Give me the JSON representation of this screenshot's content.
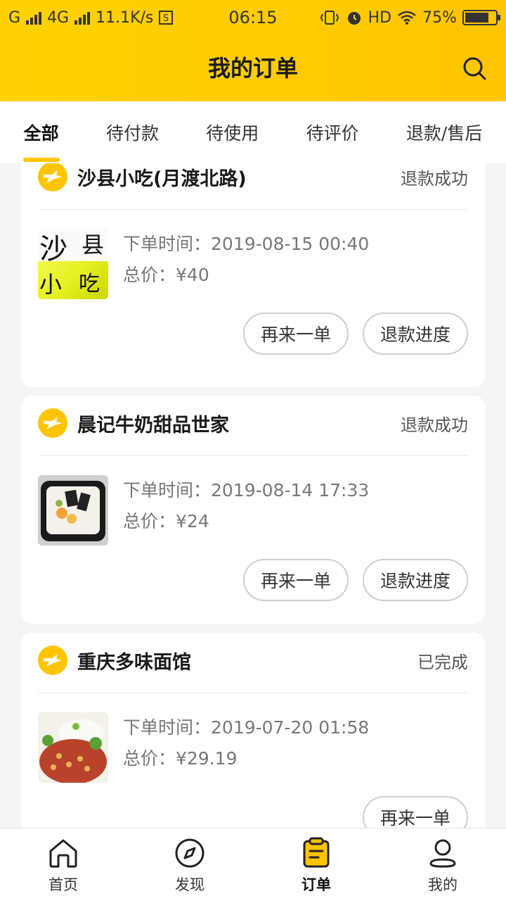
{
  "status_bar": {
    "network": "G",
    "network2": "4G",
    "speed": "11.1K/s",
    "time": "06:15",
    "hd": "HD",
    "battery": "75%"
  },
  "header": {
    "title": "我的订单"
  },
  "tabs": [
    {
      "label": "全部",
      "active": true
    },
    {
      "label": "待付款"
    },
    {
      "label": "待使用"
    },
    {
      "label": "待评价"
    },
    {
      "label": "退款/售后"
    }
  ],
  "orders": [
    {
      "shop": "沙县小吃(月渡北路)",
      "status": "退款成功",
      "time_label": "下单时间：",
      "time": "2019-08-15 00:40",
      "price_label": "总价：",
      "price": "¥40",
      "thumb_text": [
        "沙",
        "县",
        "小",
        "吃"
      ],
      "buttons": [
        "再来一单",
        "退款进度"
      ]
    },
    {
      "shop": "晨记牛奶甜品世家",
      "status": "退款成功",
      "time_label": "下单时间：",
      "time": "2019-08-14 17:33",
      "price_label": "总价：",
      "price": "¥24",
      "buttons": [
        "再来一单",
        "退款进度"
      ]
    },
    {
      "shop": "重庆多味面馆",
      "status": "已完成",
      "time_label": "下单时间：",
      "time": "2019-07-20 01:58",
      "price_label": "总价：",
      "price": "¥29.19",
      "buttons": [
        "再来一单"
      ]
    }
  ],
  "bottom_nav": [
    {
      "label": "首页",
      "icon": "home-icon"
    },
    {
      "label": "发现",
      "icon": "compass-icon"
    },
    {
      "label": "订单",
      "icon": "order-icon",
      "active": true
    },
    {
      "label": "我的",
      "icon": "user-icon"
    }
  ],
  "colors": {
    "accent": "#ffc400",
    "header_start": "#ffd200",
    "header_end": "#ffc500"
  }
}
